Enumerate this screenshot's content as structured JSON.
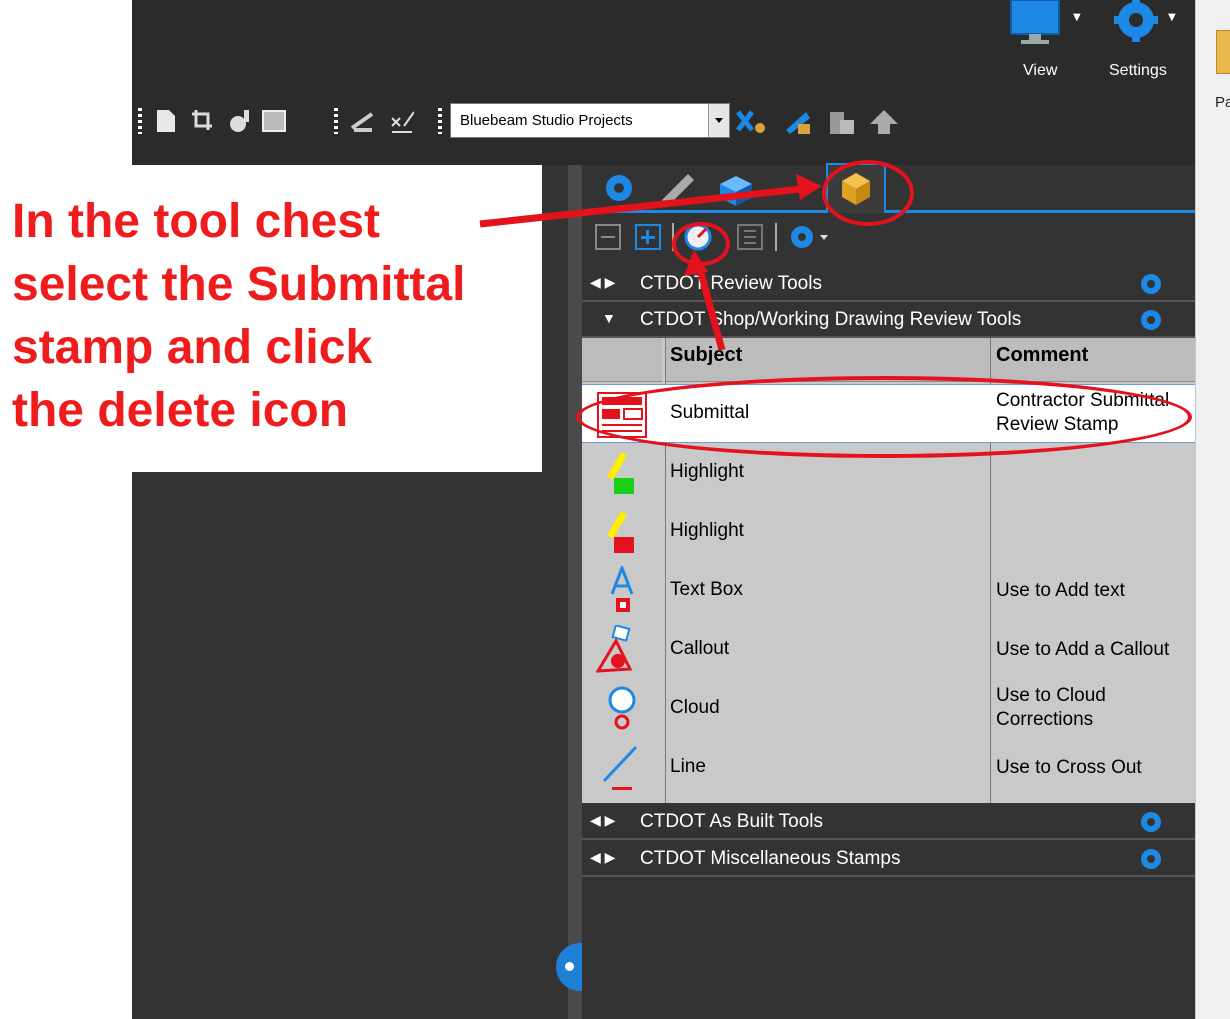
{
  "header": {
    "view_label": "View",
    "settings_label": "Settings",
    "right_pane_partial_label": "Pa"
  },
  "toolbar": {
    "project_select_value": "Bluebeam Studio Projects"
  },
  "annotation": {
    "lines": [
      "In the tool chest",
      "select the Submittal",
      "stamp and click",
      "the delete icon"
    ],
    "color": "#ee1c1c"
  },
  "tool_chest": {
    "sections": [
      {
        "title": "CTDOT Review Tools",
        "state": "collapsed"
      },
      {
        "title": "CTDOT Shop/Working Drawing Review Tools",
        "state": "expanded"
      },
      {
        "title": "CTDOT As Built Tools",
        "state": "collapsed"
      },
      {
        "title": "CTDOT Miscellaneous Stamps",
        "state": "collapsed"
      }
    ],
    "columns": {
      "subject": "Subject",
      "comment": "Comment"
    },
    "rows": [
      {
        "subject": "Submittal",
        "comment": "Contractor Submittal Review Stamp",
        "icon": "stamp-icon",
        "selected": true
      },
      {
        "subject": "Highlight",
        "comment": "",
        "icon": "highlight-green-icon"
      },
      {
        "subject": "Highlight",
        "comment": "",
        "icon": "highlight-red-icon"
      },
      {
        "subject": "Text Box",
        "comment": "Use to Add text",
        "icon": "text-box-icon"
      },
      {
        "subject": "Callout",
        "comment": "Use to Add a Callout",
        "icon": "callout-icon"
      },
      {
        "subject": "Cloud",
        "comment": "Use to Cloud Corrections",
        "icon": "cloud-icon"
      },
      {
        "subject": "Line",
        "comment": "Use to Cross Out",
        "icon": "line-icon"
      }
    ]
  },
  "colors": {
    "accent": "#1e88e5",
    "panel_bg": "#333333",
    "grid_bg": "#c9c9c9",
    "highlight_red": "#e3121c"
  }
}
